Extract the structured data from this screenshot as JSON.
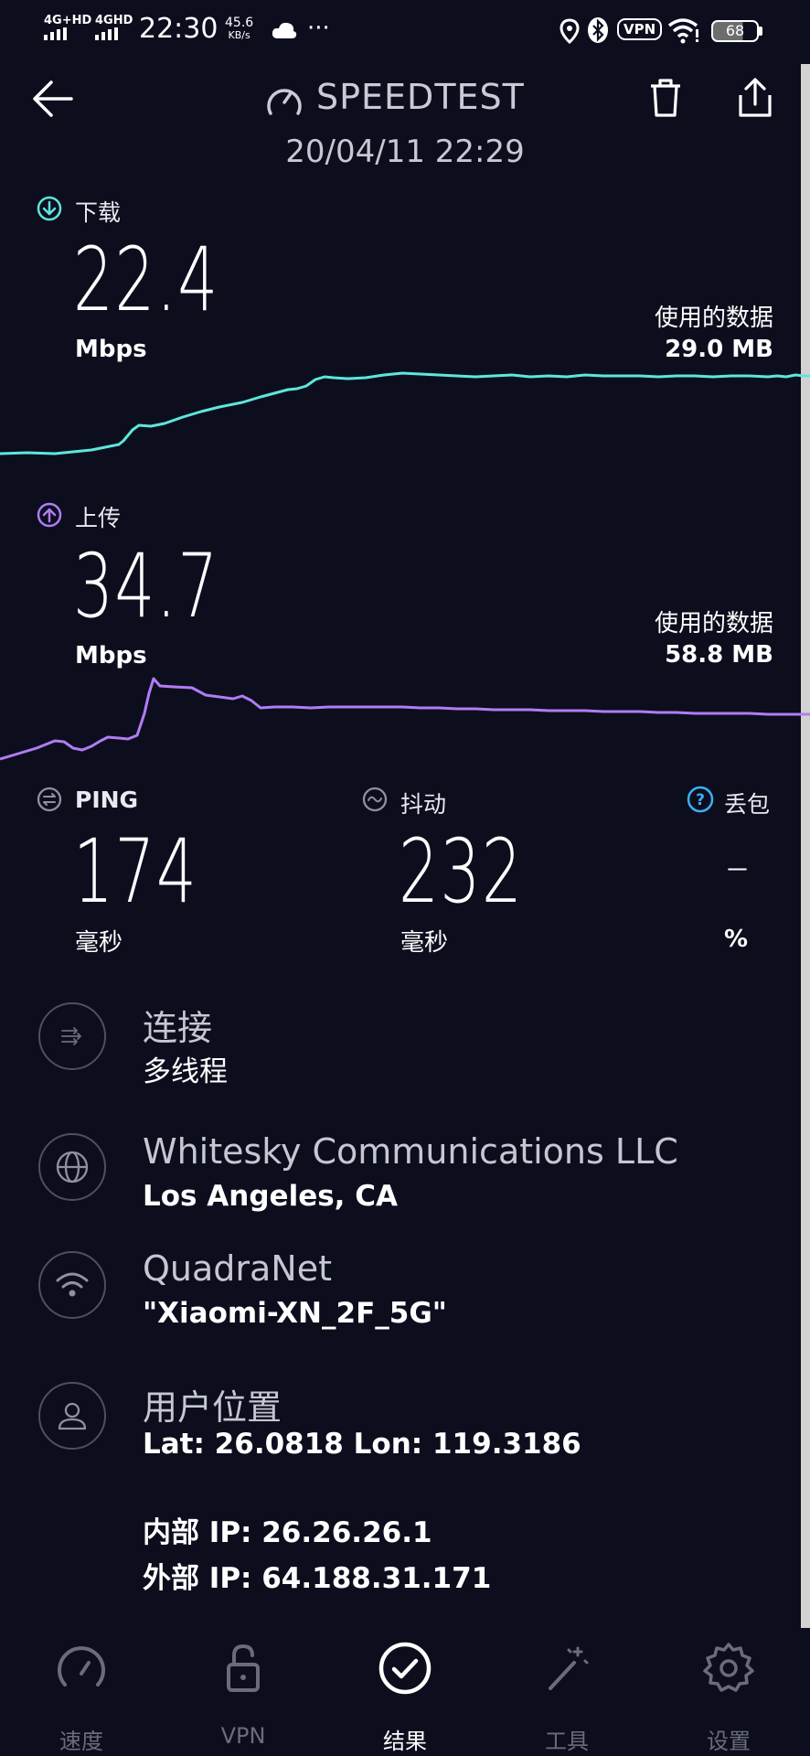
{
  "status_bar": {
    "network_1": "4G+HD",
    "network_2": "4GHD",
    "time": "22:30",
    "net_speed_value": "45.6",
    "net_speed_unit": "KB/s",
    "more": "···",
    "vpn": "VPN",
    "battery": "68"
  },
  "header": {
    "title": "SPEEDTEST",
    "datetime": "20/04/11 22:29"
  },
  "download": {
    "label": "下载",
    "value": "22.4",
    "unit": "Mbps",
    "data_used_label": "使用的数据",
    "data_used_value": "29.0 MB",
    "color": "#5ee6dc"
  },
  "upload": {
    "label": "上传",
    "value": "34.7",
    "unit": "Mbps",
    "data_used_label": "使用的数据",
    "data_used_value": "58.8 MB",
    "color": "#b17cf5"
  },
  "ping": {
    "label": "PING",
    "value": "174",
    "unit": "毫秒"
  },
  "jitter": {
    "label": "抖动",
    "value": "232",
    "unit": "毫秒"
  },
  "packet_loss": {
    "label": "丢包",
    "value": "–",
    "unit": "%"
  },
  "details": {
    "connection_title": "连接",
    "connection_value": "多线程",
    "provider_title": "Whitesky Communications LLC",
    "provider_location": "Los Angeles, CA",
    "isp_title": "QuadraNet",
    "wifi_name": "\"Xiaomi-XN_2F_5G\"",
    "location_title": "用户位置",
    "location_value": "Lat: 26.0818 Lon: 119.3186",
    "internal_ip": "内部 IP: 26.26.26.1",
    "external_ip": "外部 IP: 64.188.31.171"
  },
  "nav": {
    "speed": "速度",
    "vpn": "VPN",
    "results": "结果",
    "tools": "工具",
    "settings": "设置"
  },
  "icons": {
    "back": "arrow-left-icon",
    "gauge": "gauge-icon",
    "delete": "trash-icon",
    "share": "share-icon"
  }
}
